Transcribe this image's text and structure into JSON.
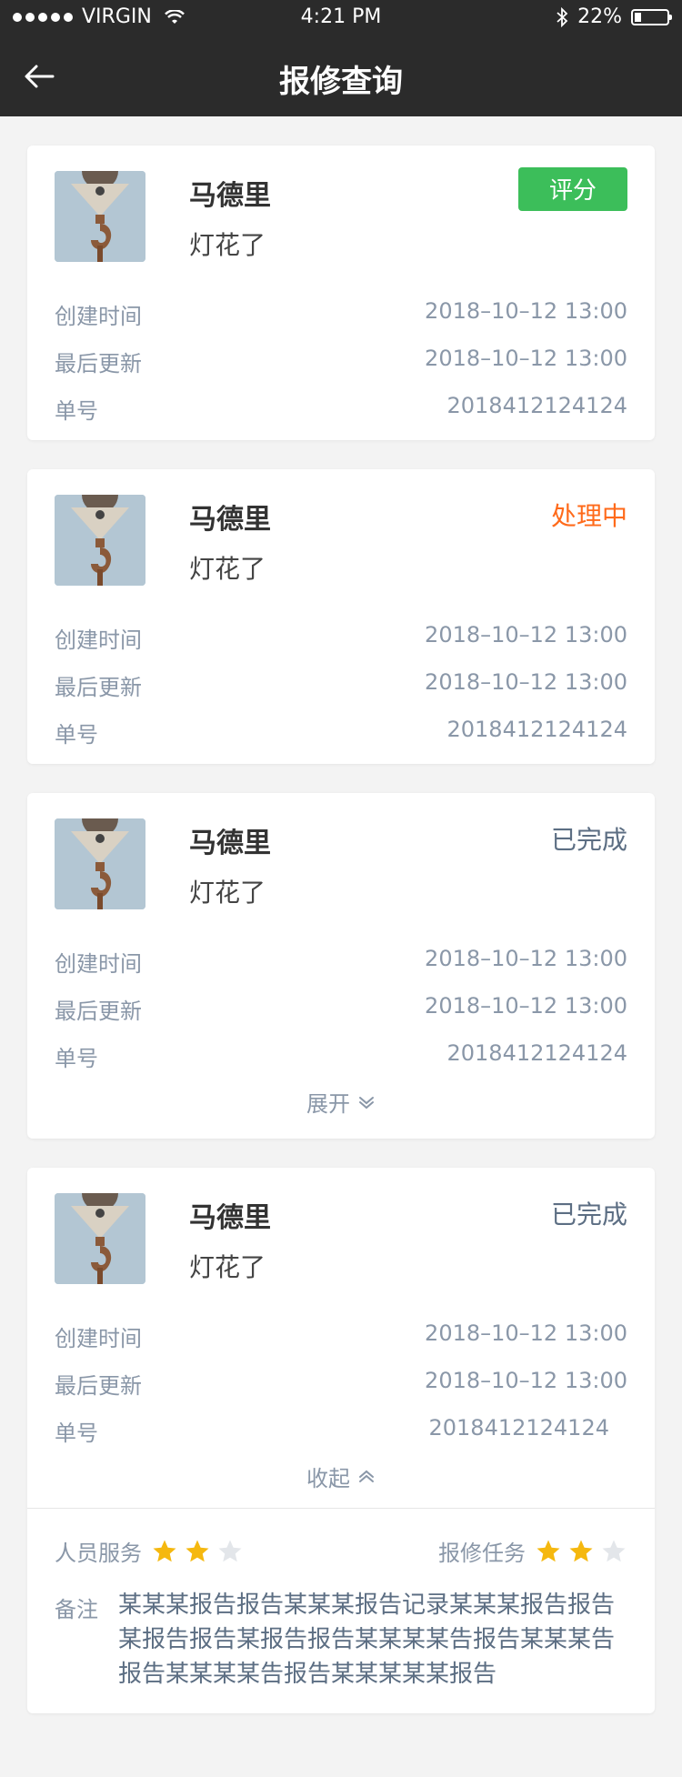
{
  "status_bar": {
    "carrier": "VIRGIN",
    "time": "4:21 PM",
    "battery": "22%",
    "signal_icon": "signal-dots-icon",
    "wifi_icon": "wifi-icon",
    "bluetooth_icon": "bluetooth-icon",
    "battery_level": 0.22
  },
  "nav": {
    "title": "报修查询",
    "back_icon": "back-arrow-icon"
  },
  "labels": {
    "created": "创建时间",
    "updated": "最后更新",
    "order_no": "单号",
    "rate_button": "评分",
    "expand": "展开",
    "collapse": "收起",
    "staff_service": "人员服务",
    "repair_task": "报修任务",
    "remark": "备注"
  },
  "cards": [
    {
      "name": "马德里",
      "description": "灯花了",
      "status": "评分",
      "created": "2018–10–12 13:00",
      "updated": "2018–10–12 13:00",
      "order_no": "2018412124124"
    },
    {
      "name": "马德里",
      "description": "灯花了",
      "status": "处理中",
      "created": "2018–10–12 13:00",
      "updated": "2018–10–12 13:00",
      "order_no": "2018412124124"
    },
    {
      "name": "马德里",
      "description": "灯花了",
      "status": "已完成",
      "created": "2018–10–12 13:00",
      "updated": "2018–10–12 13:00",
      "order_no": "2018412124124"
    },
    {
      "name": "马德里",
      "description": "灯花了",
      "status": "已完成",
      "created": "2018–10–12 13:00",
      "updated": "2018–10–12 13:00",
      "order_no": "2018412124124",
      "staff_rating": 2,
      "task_rating": 2,
      "rating_max": 3,
      "remark": "某某某报告报告某某某报告记录某某某报告报告某报告报告某报告报告某某某某告报告某某某告报告某某某某告报告某某某某某报告"
    }
  ],
  "colors": {
    "header_bg": "#2b2b2b",
    "green": "#3cbe5a",
    "orange": "#ff6a1a",
    "star_on": "#f5b80f",
    "star_off": "#e3e6ea"
  }
}
